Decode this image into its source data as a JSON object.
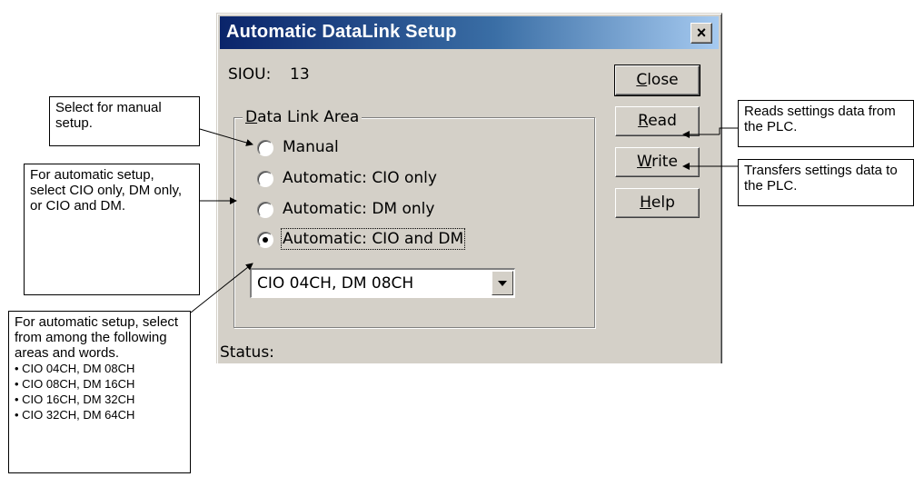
{
  "dialog": {
    "title": "Automatic DataLink Setup",
    "close_x": "×",
    "siou_label": "SIOU:",
    "siou_value": "13",
    "buttons": {
      "close_mnemonic": "C",
      "close_rest": "lose",
      "read_mnemonic": "R",
      "read_rest": "ead",
      "write_mnemonic": "W",
      "write_rest": "rite",
      "help_mnemonic": "H",
      "help_rest": "elp"
    },
    "group": {
      "mnemonic": "D",
      "rest": "ata Link Area"
    },
    "radios": [
      {
        "label": "Manual",
        "selected": false
      },
      {
        "label": "Automatic: CIO only",
        "selected": false
      },
      {
        "label": "Automatic: DM only",
        "selected": false
      },
      {
        "label": "Automatic: CIO and DM",
        "selected": true
      }
    ],
    "combo_value": "CIO 04CH, DM 08CH",
    "status_label": "Status:"
  },
  "callouts": {
    "manual": "Select for manual setup.",
    "automatic": "For automatic setup, select CIO only, DM only, or CIO and DM.",
    "areas_intro": "For automatic setup, select from among the following areas and words.",
    "areas": [
      "CIO 04CH, DM 08CH",
      "CIO 08CH, DM 16CH",
      "CIO 16CH, DM 32CH",
      "CIO 32CH, DM 64CH"
    ],
    "read": "Reads settings data from the PLC.",
    "write": "Transfers settings data to the PLC."
  }
}
